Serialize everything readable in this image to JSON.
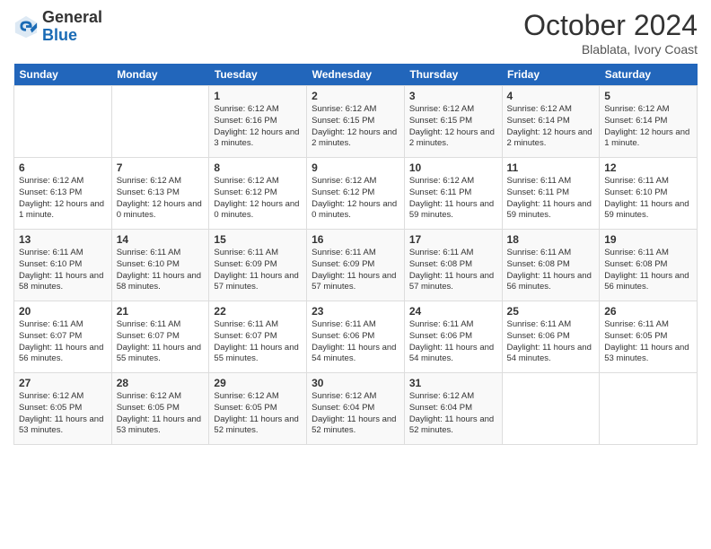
{
  "header": {
    "logo_general": "General",
    "logo_blue": "Blue",
    "title": "October 2024",
    "location": "Blablata, Ivory Coast"
  },
  "days_of_week": [
    "Sunday",
    "Monday",
    "Tuesday",
    "Wednesday",
    "Thursday",
    "Friday",
    "Saturday"
  ],
  "weeks": [
    [
      {
        "day": "",
        "info": ""
      },
      {
        "day": "",
        "info": ""
      },
      {
        "day": "1",
        "info": "Sunrise: 6:12 AM\nSunset: 6:16 PM\nDaylight: 12 hours and 3 minutes."
      },
      {
        "day": "2",
        "info": "Sunrise: 6:12 AM\nSunset: 6:15 PM\nDaylight: 12 hours and 2 minutes."
      },
      {
        "day": "3",
        "info": "Sunrise: 6:12 AM\nSunset: 6:15 PM\nDaylight: 12 hours and 2 minutes."
      },
      {
        "day": "4",
        "info": "Sunrise: 6:12 AM\nSunset: 6:14 PM\nDaylight: 12 hours and 2 minutes."
      },
      {
        "day": "5",
        "info": "Sunrise: 6:12 AM\nSunset: 6:14 PM\nDaylight: 12 hours and 1 minute."
      }
    ],
    [
      {
        "day": "6",
        "info": "Sunrise: 6:12 AM\nSunset: 6:13 PM\nDaylight: 12 hours and 1 minute."
      },
      {
        "day": "7",
        "info": "Sunrise: 6:12 AM\nSunset: 6:13 PM\nDaylight: 12 hours and 0 minutes."
      },
      {
        "day": "8",
        "info": "Sunrise: 6:12 AM\nSunset: 6:12 PM\nDaylight: 12 hours and 0 minutes."
      },
      {
        "day": "9",
        "info": "Sunrise: 6:12 AM\nSunset: 6:12 PM\nDaylight: 12 hours and 0 minutes."
      },
      {
        "day": "10",
        "info": "Sunrise: 6:12 AM\nSunset: 6:11 PM\nDaylight: 11 hours and 59 minutes."
      },
      {
        "day": "11",
        "info": "Sunrise: 6:11 AM\nSunset: 6:11 PM\nDaylight: 11 hours and 59 minutes."
      },
      {
        "day": "12",
        "info": "Sunrise: 6:11 AM\nSunset: 6:10 PM\nDaylight: 11 hours and 59 minutes."
      }
    ],
    [
      {
        "day": "13",
        "info": "Sunrise: 6:11 AM\nSunset: 6:10 PM\nDaylight: 11 hours and 58 minutes."
      },
      {
        "day": "14",
        "info": "Sunrise: 6:11 AM\nSunset: 6:10 PM\nDaylight: 11 hours and 58 minutes."
      },
      {
        "day": "15",
        "info": "Sunrise: 6:11 AM\nSunset: 6:09 PM\nDaylight: 11 hours and 57 minutes."
      },
      {
        "day": "16",
        "info": "Sunrise: 6:11 AM\nSunset: 6:09 PM\nDaylight: 11 hours and 57 minutes."
      },
      {
        "day": "17",
        "info": "Sunrise: 6:11 AM\nSunset: 6:08 PM\nDaylight: 11 hours and 57 minutes."
      },
      {
        "day": "18",
        "info": "Sunrise: 6:11 AM\nSunset: 6:08 PM\nDaylight: 11 hours and 56 minutes."
      },
      {
        "day": "19",
        "info": "Sunrise: 6:11 AM\nSunset: 6:08 PM\nDaylight: 11 hours and 56 minutes."
      }
    ],
    [
      {
        "day": "20",
        "info": "Sunrise: 6:11 AM\nSunset: 6:07 PM\nDaylight: 11 hours and 56 minutes."
      },
      {
        "day": "21",
        "info": "Sunrise: 6:11 AM\nSunset: 6:07 PM\nDaylight: 11 hours and 55 minutes."
      },
      {
        "day": "22",
        "info": "Sunrise: 6:11 AM\nSunset: 6:07 PM\nDaylight: 11 hours and 55 minutes."
      },
      {
        "day": "23",
        "info": "Sunrise: 6:11 AM\nSunset: 6:06 PM\nDaylight: 11 hours and 54 minutes."
      },
      {
        "day": "24",
        "info": "Sunrise: 6:11 AM\nSunset: 6:06 PM\nDaylight: 11 hours and 54 minutes."
      },
      {
        "day": "25",
        "info": "Sunrise: 6:11 AM\nSunset: 6:06 PM\nDaylight: 11 hours and 54 minutes."
      },
      {
        "day": "26",
        "info": "Sunrise: 6:11 AM\nSunset: 6:05 PM\nDaylight: 11 hours and 53 minutes."
      }
    ],
    [
      {
        "day": "27",
        "info": "Sunrise: 6:12 AM\nSunset: 6:05 PM\nDaylight: 11 hours and 53 minutes."
      },
      {
        "day": "28",
        "info": "Sunrise: 6:12 AM\nSunset: 6:05 PM\nDaylight: 11 hours and 53 minutes."
      },
      {
        "day": "29",
        "info": "Sunrise: 6:12 AM\nSunset: 6:05 PM\nDaylight: 11 hours and 52 minutes."
      },
      {
        "day": "30",
        "info": "Sunrise: 6:12 AM\nSunset: 6:04 PM\nDaylight: 11 hours and 52 minutes."
      },
      {
        "day": "31",
        "info": "Sunrise: 6:12 AM\nSunset: 6:04 PM\nDaylight: 11 hours and 52 minutes."
      },
      {
        "day": "",
        "info": ""
      },
      {
        "day": "",
        "info": ""
      }
    ]
  ]
}
